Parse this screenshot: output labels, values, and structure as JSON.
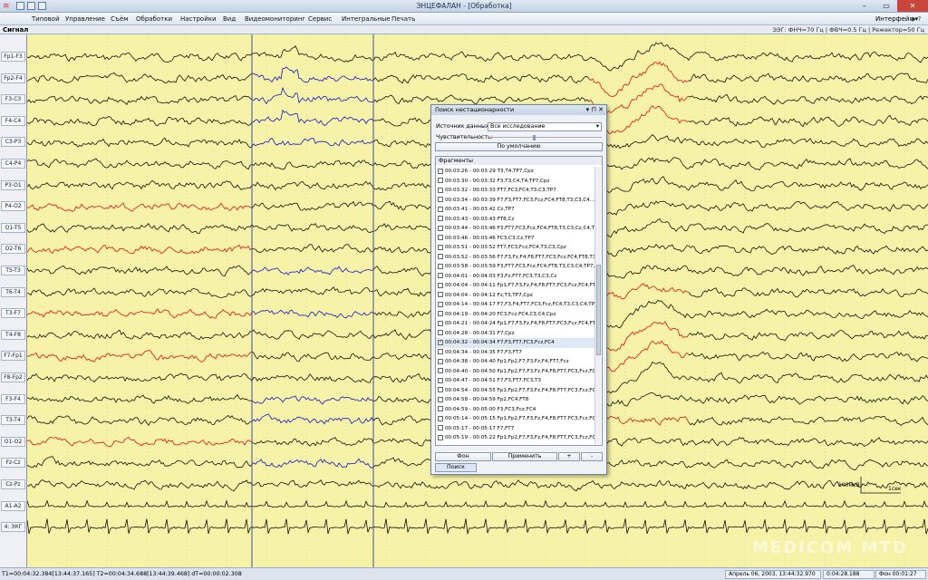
{
  "window": {
    "title": "ЭНЦЕФАЛАН - [Обработка]"
  },
  "menu": [
    "Типовой",
    "Управление",
    "Съём",
    "Обработки",
    "Настройки",
    "Вид",
    "Видеомониторинг",
    "Сервис",
    "Интегральные",
    "Печать"
  ],
  "interface_menu": "Интерфейс",
  "toolbar": {
    "signal_label": "Сигнал",
    "filter_info": "ЭЭГ: ФНЧ=70 Гц | ФВЧ=0.5 Гц | Режектор=50 Гц"
  },
  "channels": [
    "Fp1-F3",
    "Fp2-F4",
    "F3-C3",
    "F4-C4",
    "C3-P3",
    "C4-P4",
    "P3-O1",
    "P4-O2",
    "O1-T5",
    "O2-T6",
    "T5-T3",
    "T6-T4",
    "T3-F7",
    "T4-F8",
    "F7-Fp1",
    "F8-Fp2",
    "F3-F4",
    "T3-T4",
    "O1-O2",
    "Fz-Cz",
    "Cz-Pz",
    "A1-A2",
    "4: ЭКГ"
  ],
  "colors": {
    "trace_black": "#111111",
    "trace_red": "#e01010",
    "trace_blue": "#1515c8",
    "background": "#f6f2a8",
    "selection_line": "#3d4fa3"
  },
  "scale": {
    "amplitude": "100мкВ",
    "time": "1сек"
  },
  "watermark": "MEDICOM MTD",
  "dialog": {
    "title": "Поиск нестационарности",
    "source_label": "Источник данных:",
    "source_value": "Все исследование",
    "sensitivity_label": "Чувствительность:",
    "default_button": "По умолчанию",
    "fragments_label": "Фрагменты",
    "fragments": [
      {
        "t": "00:03:26 - 00:03:29",
        "ch": "T3,T4,TP7,Cpz",
        "checked": false
      },
      {
        "t": "00:03:30 - 00:03:32",
        "ch": "F3,T3,C4,T4,TP7,Cpz",
        "checked": false
      },
      {
        "t": "00:03:32 - 00:03:33",
        "ch": "FT7,FC3,FC4,T3,C3,TP7",
        "checked": false
      },
      {
        "t": "00:03:34 - 00:03:39",
        "ch": "F7,F3,FT7,FC3,Fcz,FC4,FT8,T3,C3,C4...",
        "checked": false
      },
      {
        "t": "00:03:41 - 00:03:42",
        "ch": "Cz,TP7",
        "checked": false
      },
      {
        "t": "00:03:43 - 00:03:43",
        "ch": "FT8,Cz",
        "checked": false
      },
      {
        "t": "00:03:44 - 00:03:46",
        "ch": "F3,FT7,FC3,Fcz,FC4,FT8,T3,C3,Cz,C4,T4",
        "checked": false
      },
      {
        "t": "00:03:46 - 00:03:46",
        "ch": "FC3,C3,Cz,TP7",
        "checked": false
      },
      {
        "t": "00:03:51 - 00:03:52",
        "ch": "FT7,FC3,Fcz,FC4,T3,C3,Cpz",
        "checked": false
      },
      {
        "t": "00:03:52 - 00:03:56",
        "ch": "F7,F3,Fz,F4,F8,FT7,FC3,Fcz,FC4,FT8,T3,C...",
        "checked": false
      },
      {
        "t": "00:03:58 - 00:03:59",
        "ch": "F3,FT7,FC3,Fcz,FC4,FT8,T3,C3,C4,TP7,Cpz",
        "checked": false
      },
      {
        "t": "00:04:01 - 00:04:03",
        "ch": "F3,Fz,FT7,FC3,T3,C3,Cz",
        "checked": false
      },
      {
        "t": "00:04:04 - 00:04:11",
        "ch": "Fp1,F7,F3,Fz,F4,F8,FT7,FC3,Fcz,FC4,FT8,...",
        "checked": false
      },
      {
        "t": "00:04:04 - 00:04:12",
        "ch": "Fz,T3,TP7,Cpz",
        "checked": false
      },
      {
        "t": "00:04:14 - 00:04:17",
        "ch": "F7,F3,F4,FT7,FC3,Fcz,FC4,T3,C3,C4,TP7",
        "checked": false
      },
      {
        "t": "00:04:19 - 00:04:20",
        "ch": "FC3,Fcz,FC4,C3,C4,Cpz",
        "checked": false
      },
      {
        "t": "00:04:21 - 00:04:24",
        "ch": "Fp1,F7,F3,Fz,F4,F8,FT7,FC3,Fcz,FC4,FT8,...",
        "checked": false
      },
      {
        "t": "00:04:28 - 00:04:31",
        "ch": "F7,Cpz",
        "checked": false
      },
      {
        "t": "00:04:32 - 00:04:34",
        "ch": "F7,F3,FT7,FC3,Fcz,FC4",
        "checked": true
      },
      {
        "t": "00:04:34 - 00:04:35",
        "ch": "F7,F3,FT7",
        "checked": false
      },
      {
        "t": "00:04:38 - 00:04:40",
        "ch": "Fp1,Fp2,F7,F3,Fz,F4,FT7,Fcz",
        "checked": false
      },
      {
        "t": "00:04:40 - 00:04:50",
        "ch": "Fp1,Fp2,F7,F3,Fz,F4,F8,FT7,FC3,Fcz,FC4,FT8,...",
        "checked": false
      },
      {
        "t": "00:04:47 - 00:04:51",
        "ch": "F7,F3,FT7,FC3,T3",
        "checked": false
      },
      {
        "t": "00:04:54 - 00:04:55",
        "ch": "Fp1,Fp2,F7,F3,Fz,F4,F8,FT7,FC3,Fcz,FC4,...",
        "checked": false
      },
      {
        "t": "00:04:58 - 00:04:59",
        "ch": "Fp2,FC4,FT8",
        "checked": false
      },
      {
        "t": "00:04:59 - 00:05:00",
        "ch": "F3,FC3,Fcz,FC4",
        "checked": false
      },
      {
        "t": "00:05:14 - 00:05:15",
        "ch": "Fp1,Fp2,F7,F3,Fz,F4,F8,FT7,FC3,Fcz,FC4",
        "checked": false
      },
      {
        "t": "00:05:17 - 00:05:17",
        "ch": "F7,FT7",
        "checked": false
      },
      {
        "t": "00:05:19 - 00:05:22",
        "ch": "Fp1,Fp2,F7,F3,Fz,F4,F8,FT7,FC3,Fcz,FC4,FT8...",
        "checked": false
      },
      {
        "t": "00:05:22 - 00:05:23",
        "ch": "FT7,FC3,T3",
        "checked": false
      }
    ],
    "bg_button": "Фон",
    "apply_button": "Применить",
    "plus_button": "+",
    "minus_button": "-",
    "search_button": "Поиск"
  },
  "status": {
    "cursor_info": "T1=00:04:32.384[13:44:37.165] T2=00:04:34.688[13:44:39.468] dT=00:00:02.308",
    "date": "Апрель 06, 2003, 13:44:32.970",
    "position": "0:04:28.188",
    "bg_off": "Фон 00:01:27"
  }
}
